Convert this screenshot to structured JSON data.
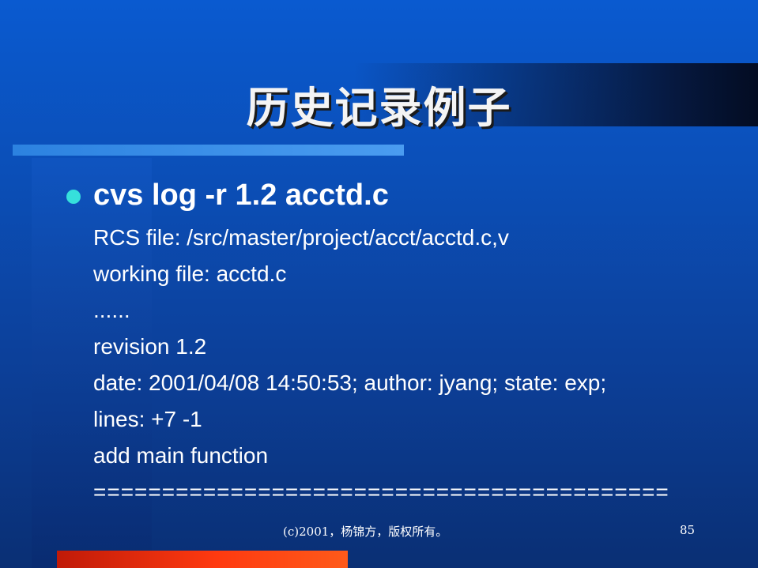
{
  "slide": {
    "title": "历史记录例子",
    "bullet": "cvs log -r 1.2 acctd.c",
    "lines": [
      "RCS file: /src/master/project/acct/acctd.c,v",
      "working file: acctd.c",
      "......",
      "revision 1.2",
      "date: 2001/04/08 14:50:53;  author: jyang;  state: exp;",
      "lines: +7 -1",
      "add main function",
      "=========================================="
    ],
    "footer": "(c)2001，杨锦方，版权所有。",
    "page_number": "85"
  },
  "colors": {
    "background": "#0b4fb8",
    "bullet_dot": "#36e0dc",
    "accent_strip": "#4a9cf0",
    "footer_bar": "#ff3a10",
    "text": "#ffffff"
  }
}
